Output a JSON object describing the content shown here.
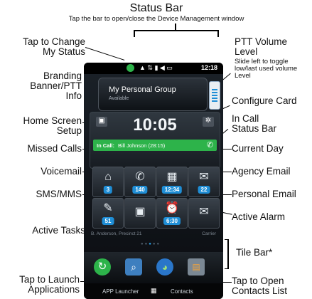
{
  "header": {
    "title": "Status Bar",
    "subtitle": "Tap the bar to open/close the Device Management window"
  },
  "callouts": {
    "change_status": "Tap to Change\nMy Status",
    "ptt_volume": "PTT Volume\nLevel",
    "ptt_volume_note": "Slide left to toggle\nlow/last used volume\nLevel",
    "branding": "Branding\nBanner/PTT\nInfo",
    "configure_card": "Configure Card",
    "home_setup": "Home Screen\nSetup",
    "in_call_status": "In Call\nStatus Bar",
    "missed_calls": "Missed Calls",
    "current_day": "Current Day",
    "voicemail": "Voicemail",
    "agency_email": "Agency Email",
    "personal_email": "Personal Email",
    "sms": "SMS/MMS",
    "active_alarm": "Active Alarm",
    "active_tasks": "Active Tasks",
    "tile_bar": "Tile Bar*",
    "launch_apps": "Tap to Launch\nApplications",
    "open_contacts": "Tap to Open\nContacts List"
  },
  "phone": {
    "status_time": "12:18",
    "group_name": "My Personal Group",
    "group_status": "Available",
    "clock": "10:05",
    "incall_label": "In Call:",
    "incall_text": "Bill Johnson (28:15)",
    "tiles": {
      "voicemail_count": "3",
      "missed_count": "140",
      "day": "12:34",
      "agency_count": "22",
      "sms_count": "51",
      "alarm": "6:30"
    },
    "info_left": "B. Anderson, Precinct 21",
    "info_right": "Carrier",
    "app_launcher": "APP Launcher",
    "contacts": "Contacts"
  },
  "colors": {
    "accent_green": "#2db34a",
    "badge_blue": "#1f8ed6",
    "phone_bg": "#0d0f12"
  }
}
